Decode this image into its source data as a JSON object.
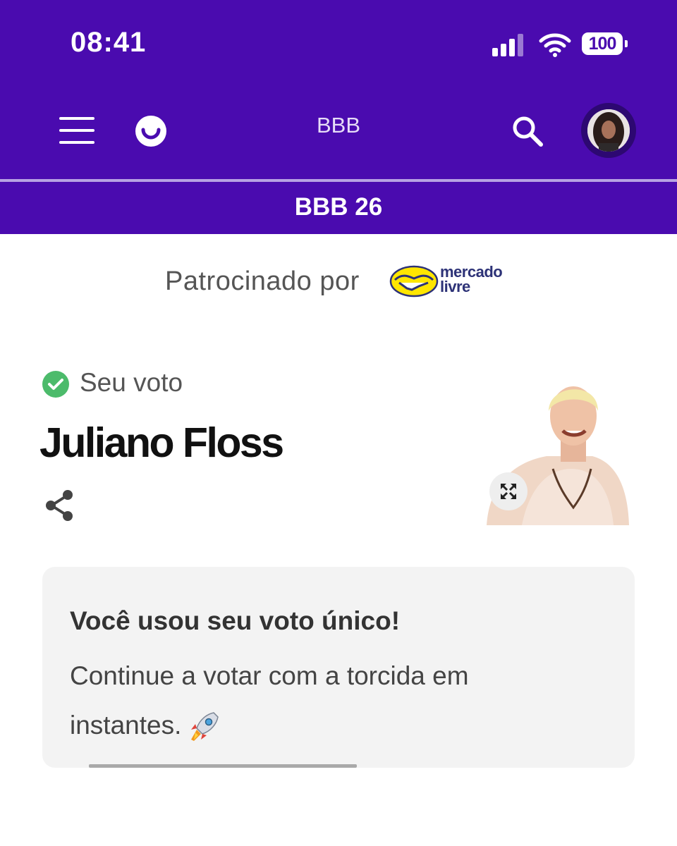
{
  "status_bar": {
    "time": "08:41",
    "battery": "100",
    "icons": [
      "cellular-signal-icon",
      "wifi-icon",
      "battery-icon"
    ]
  },
  "header": {
    "title": "BBB",
    "section": "BBB 26",
    "icons": [
      "menu-icon",
      "logo-icon",
      "search-icon",
      "avatar"
    ],
    "colors": {
      "background": "#4a0baf",
      "divider": "#b8a2e3"
    }
  },
  "sponsor": {
    "label": "Patrocinado por",
    "brand_line1": "mercado",
    "brand_line2": "livre",
    "logo_icon": "handshake-icon"
  },
  "vote": {
    "status_icon": "check-circle-icon",
    "status_label": "Seu voto",
    "candidate": "Juliano Floss",
    "share_icon": "share-icon",
    "expand_icon": "expand-icon"
  },
  "card": {
    "title": "Você usou seu voto único!",
    "body": "Continue a votar com a torcida em instantes.",
    "emoji_icon": "rocket-icon"
  },
  "colors": {
    "accent": "#4a0baf",
    "check": "#4cbb6b",
    "card_bg": "#f3f3f3"
  }
}
